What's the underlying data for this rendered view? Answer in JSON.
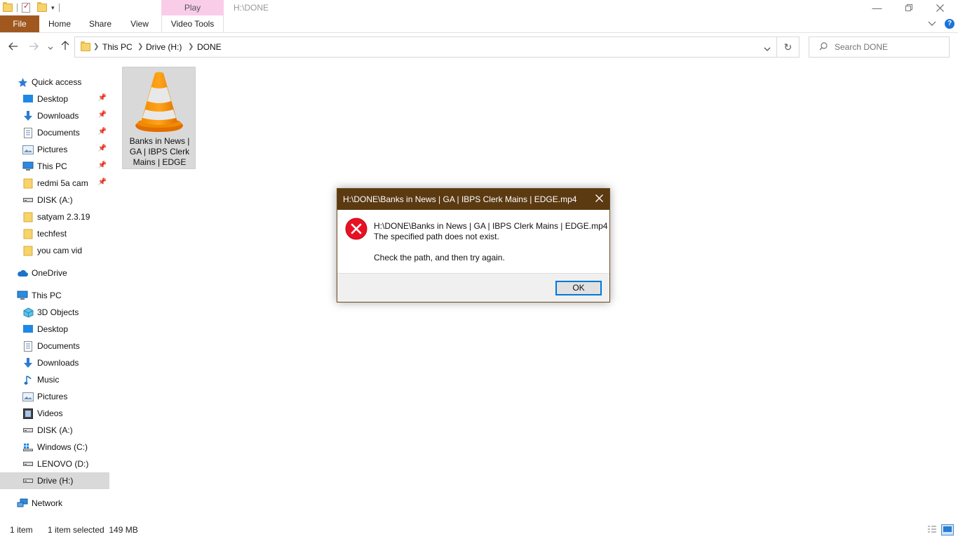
{
  "window": {
    "title": "H:\\DONE",
    "context_tab_top": "Play",
    "minimize_icon": "minimize-icon",
    "restore_icon": "restore-icon",
    "close_icon": "close-icon"
  },
  "ribbon": {
    "tabs": [
      "File",
      "Home",
      "Share",
      "View",
      "Video Tools"
    ],
    "file_color": "#a0581f",
    "context_color": "#f9cde8"
  },
  "address": {
    "crumbs": [
      "This PC",
      "Drive (H:)",
      "DONE"
    ],
    "search_placeholder": "Search DONE"
  },
  "sidebar": {
    "quick_access": {
      "label": "Quick access",
      "items": [
        {
          "label": "Desktop",
          "icon": "desktop-icon",
          "pinned": true
        },
        {
          "label": "Downloads",
          "icon": "download-icon",
          "pinned": true
        },
        {
          "label": "Documents",
          "icon": "document-icon",
          "pinned": true
        },
        {
          "label": "Pictures",
          "icon": "pictures-icon",
          "pinned": true
        },
        {
          "label": "This PC",
          "icon": "computer-icon",
          "pinned": true
        },
        {
          "label": "redmi 5a cam",
          "icon": "folder-icon",
          "pinned": true
        },
        {
          "label": "DISK (A:)",
          "icon": "drive-icon",
          "pinned": false
        },
        {
          "label": "satyam 2.3.19",
          "icon": "folder-icon",
          "pinned": false
        },
        {
          "label": "techfest",
          "icon": "folder-icon",
          "pinned": false
        },
        {
          "label": "you cam vid",
          "icon": "folder-icon",
          "pinned": false
        }
      ]
    },
    "onedrive": {
      "label": "OneDrive"
    },
    "this_pc": {
      "label": "This PC",
      "items": [
        {
          "label": "3D Objects",
          "icon": "3d-objects-icon"
        },
        {
          "label": "Desktop",
          "icon": "desktop-icon"
        },
        {
          "label": "Documents",
          "icon": "document-icon"
        },
        {
          "label": "Downloads",
          "icon": "download-icon"
        },
        {
          "label": "Music",
          "icon": "music-icon"
        },
        {
          "label": "Pictures",
          "icon": "pictures-icon"
        },
        {
          "label": "Videos",
          "icon": "videos-icon"
        },
        {
          "label": "DISK (A:)",
          "icon": "drive-icon"
        },
        {
          "label": "Windows (C:)",
          "icon": "windows-drive-icon"
        },
        {
          "label": "LENOVO (D:)",
          "icon": "drive-icon"
        },
        {
          "label": "Drive (H:)",
          "icon": "drive-icon",
          "selected": true
        }
      ]
    },
    "network": {
      "label": "Network"
    }
  },
  "content": {
    "files": [
      {
        "name": "Banks in News | GA | IBPS Clerk Mains | EDGE",
        "icon": "vlc-cone-icon",
        "selected": true
      }
    ]
  },
  "status": {
    "item_count": "1 item",
    "selection": "1 item selected  149 MB"
  },
  "dialog": {
    "title": "H:\\DONE\\Banks in News | GA | IBPS Clerk Mains | EDGE.mp4",
    "line1": "H:\\DONE\\Banks in News | GA | IBPS Clerk Mains | EDGE.mp4",
    "line2": "The specified path does not exist.",
    "line3": "Check the path, and then try again.",
    "ok_label": "OK",
    "icon": "error-icon",
    "title_color": "#5b3a12",
    "error_color": "#e81123"
  }
}
